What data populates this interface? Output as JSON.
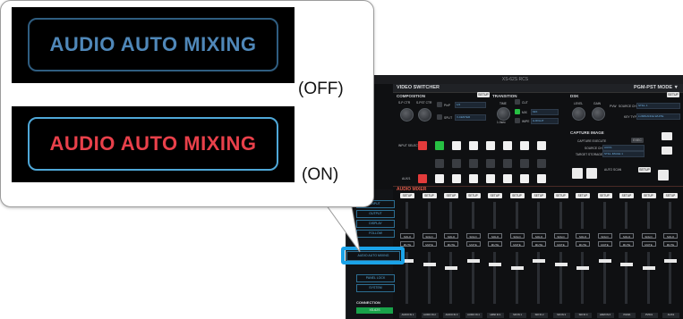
{
  "callout": {
    "off": {
      "button_label": "AUDIO AUTO MIXING",
      "state_label": "(OFF)",
      "color": "#4f87b8"
    },
    "on": {
      "button_label": "AUDIO AUTO MIXING",
      "state_label": "(ON)",
      "color": "#e8404a",
      "border_color": "#4fa8d8"
    }
  },
  "app": {
    "title": "XS-62S RCS",
    "header": {
      "left": "VIDEO SWITCHER",
      "right": "PGM-PST MODE ▼"
    },
    "composition": {
      "label": "COMPOSITION",
      "setup": "SETUP",
      "knobs": [
        "S-P CTR",
        "S-PST CTR"
      ],
      "pinp_label": "PinP",
      "split_label": "SPLIT",
      "pinp_value": "1/2",
      "split_value": "V-CENTER"
    },
    "transition": {
      "label": "TRANSITION",
      "time": "TIME",
      "time_value": "1.0sec",
      "options": [
        "CUT",
        "MIX",
        "WIPE"
      ],
      "mix_value": "MIX",
      "wipe_value": "H-RIGHT"
    },
    "dsk": {
      "label": "DSK",
      "setup": "SETUP",
      "level": "LEVEL",
      "gain": "GAIN",
      "pvw": "PVW",
      "source_ch": "SOURCE CH",
      "source_value": "STILL 1",
      "key_type": "KEY TYPE",
      "key_value": "LUMINANCE-WHITE"
    },
    "capture": {
      "label": "CAPTURE IMAGE",
      "execute": "CAPTURE EXECUTE",
      "exec_btn": "EXEC",
      "source_ch": "SOURCE CH",
      "source_value": "AUX/1",
      "target": "TARGET STORAGE",
      "target_value": "STILL IMAGE 1"
    },
    "input_select": "INPUT SELECT",
    "aux": "AUX/1",
    "auto_scan": "AUTO SCAN",
    "mixer_label": "AUDIO MIXER",
    "channel": {
      "setup": "SETUP",
      "solo": "SOLO",
      "mute": "MUTE"
    },
    "channels": [
      "AUDIO IN 1",
      "AUDIO IN 2",
      "AUDIO IN 3",
      "AUDIO IN 4",
      "HDMI IN 1",
      "SDI IN 1",
      "SDI IN 2",
      "SDI IN 3",
      "SDI IN 4",
      "HDMI IN 6",
      "PGM/1",
      "PVW/1",
      "AUX/1"
    ],
    "nav": [
      "INPUT",
      "OUTPUT",
      "DISPLAY",
      "FOLLOW",
      "AUDIO AUTO MIXING",
      "PANEL LOCK",
      "SYSTEM"
    ],
    "connection": {
      "label": "CONNECTION",
      "status": "XS-62S"
    }
  }
}
